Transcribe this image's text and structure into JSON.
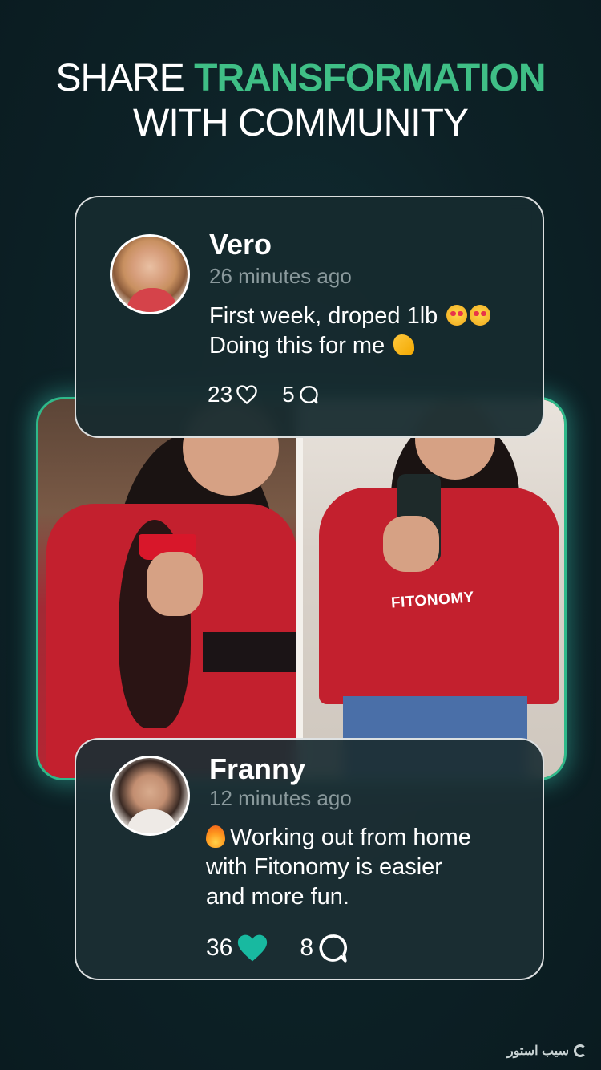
{
  "headline": {
    "line1_prefix": "SHARE ",
    "line1_accent": "TRANSFORMATION",
    "line2": "WITH COMMUNITY",
    "accent_color": "#3fbf86"
  },
  "photo_card": {
    "brand_on_shirt": "FITONOMY",
    "glow_color": "#2fb98a"
  },
  "posts": [
    {
      "name": "Vero",
      "time": "26 minutes ago",
      "line1": "First week, droped 1lb",
      "line2": "Doing this for me",
      "likes": "23",
      "comments": "5",
      "liked": false
    },
    {
      "name": "Franny",
      "time": "12 minutes ago",
      "line1": "Working out from home",
      "line2": "with Fitonomy is easier",
      "line3": "and more fun.",
      "likes": "36",
      "comments": "8",
      "liked": true,
      "heart_color": "#18b9a0"
    }
  ],
  "watermark": "سیب استور"
}
